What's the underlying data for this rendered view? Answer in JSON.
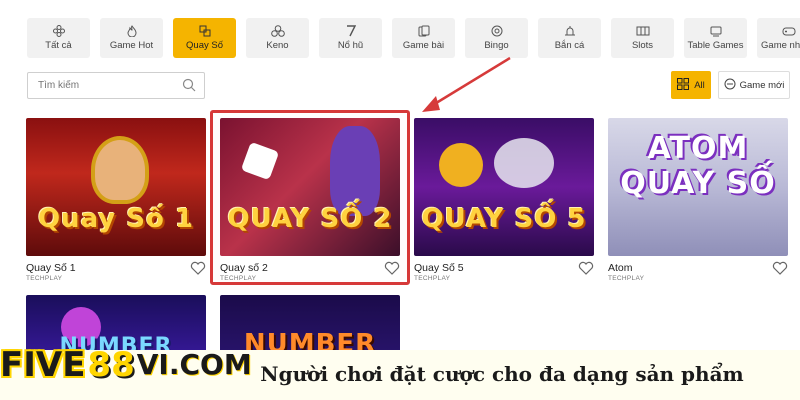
{
  "categories": [
    {
      "label": "Tất cả",
      "icon": "all-games-icon"
    },
    {
      "label": "Game Hot",
      "icon": "fire-icon"
    },
    {
      "label": "Quay Số",
      "icon": "lottery-icon",
      "active": true
    },
    {
      "label": "Keno",
      "icon": "balls-icon"
    },
    {
      "label": "Nổ hũ",
      "icon": "slot-seven-icon"
    },
    {
      "label": "Game bài",
      "icon": "cards-icon"
    },
    {
      "label": "Bingo",
      "icon": "bingo-icon"
    },
    {
      "label": "Bắn cá",
      "icon": "fishing-icon"
    },
    {
      "label": "Slots",
      "icon": "slots-icon"
    },
    {
      "label": "Table Games",
      "icon": "table-icon"
    },
    {
      "label": "Game nhanh",
      "icon": "controller-icon"
    }
  ],
  "search": {
    "placeholder": "Tìm kiếm"
  },
  "filters": {
    "all_label": "All",
    "new_label": "Game mới"
  },
  "games": [
    {
      "title": "Quay Số 1",
      "provider": "TECHPLAY",
      "art": "Quay Số 1"
    },
    {
      "title": "Quay số 2",
      "provider": "TECHPLAY",
      "art": "QUAY SỐ 2"
    },
    {
      "title": "Quay Số 5",
      "provider": "TECHPLAY",
      "art": "QUAY SỐ 5"
    },
    {
      "title": "Atom",
      "provider": "TECHPLAY",
      "art": "ATOM QUAY SỐ"
    }
  ],
  "second_row": [
    {
      "art": "NUMBER"
    },
    {
      "art": "NUMBER"
    }
  ],
  "branding": {
    "logo_part1": "FIVE",
    "logo_part2": "88",
    "logo_part3": "VI.COM"
  },
  "caption": "Người chơi đặt cược cho đa dạng sản phẩm",
  "colors": {
    "accent": "#f5b400",
    "highlight": "#d63a3a"
  }
}
